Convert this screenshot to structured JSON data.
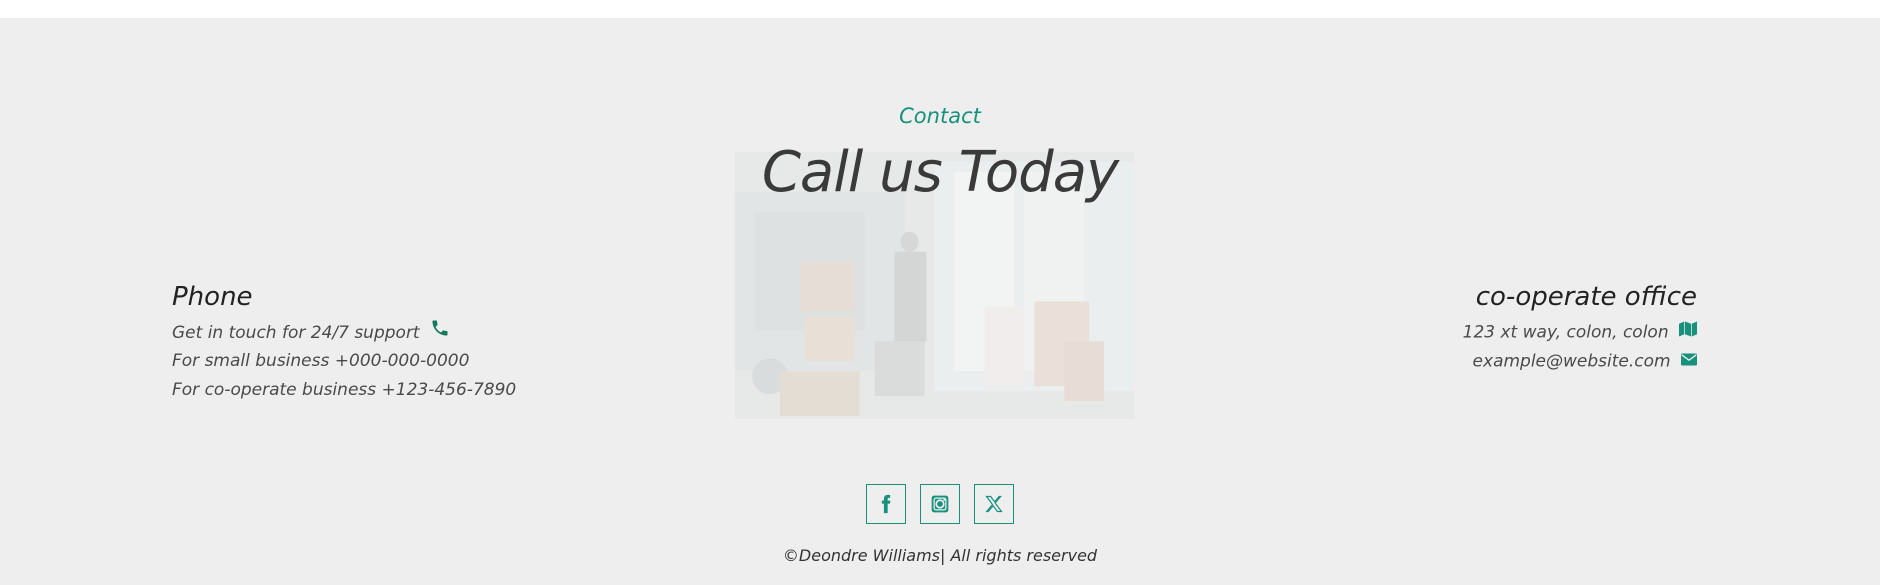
{
  "contact": {
    "eyebrow": "Contact",
    "heading": "Call us Today"
  },
  "phone": {
    "title": "Phone",
    "lines": [
      "Get in touch for 24/7 support",
      "For small business +000-000-0000",
      "For co-operate business +123-456-7890"
    ],
    "icon": "phone-icon"
  },
  "office": {
    "title": "co-operate office",
    "address": "123 xt way, colon, colon",
    "email": "example@website.com",
    "icons": [
      "map-icon",
      "envelope-icon"
    ]
  },
  "social": {
    "icons": [
      "facebook-icon",
      "instagram-icon",
      "x-twitter-icon"
    ]
  },
  "footer": {
    "copyright": "©Deondre Williams| All rights reserved"
  },
  "colors": {
    "accent": "#17917c",
    "background": "#eeeeee",
    "text": "#333333"
  }
}
